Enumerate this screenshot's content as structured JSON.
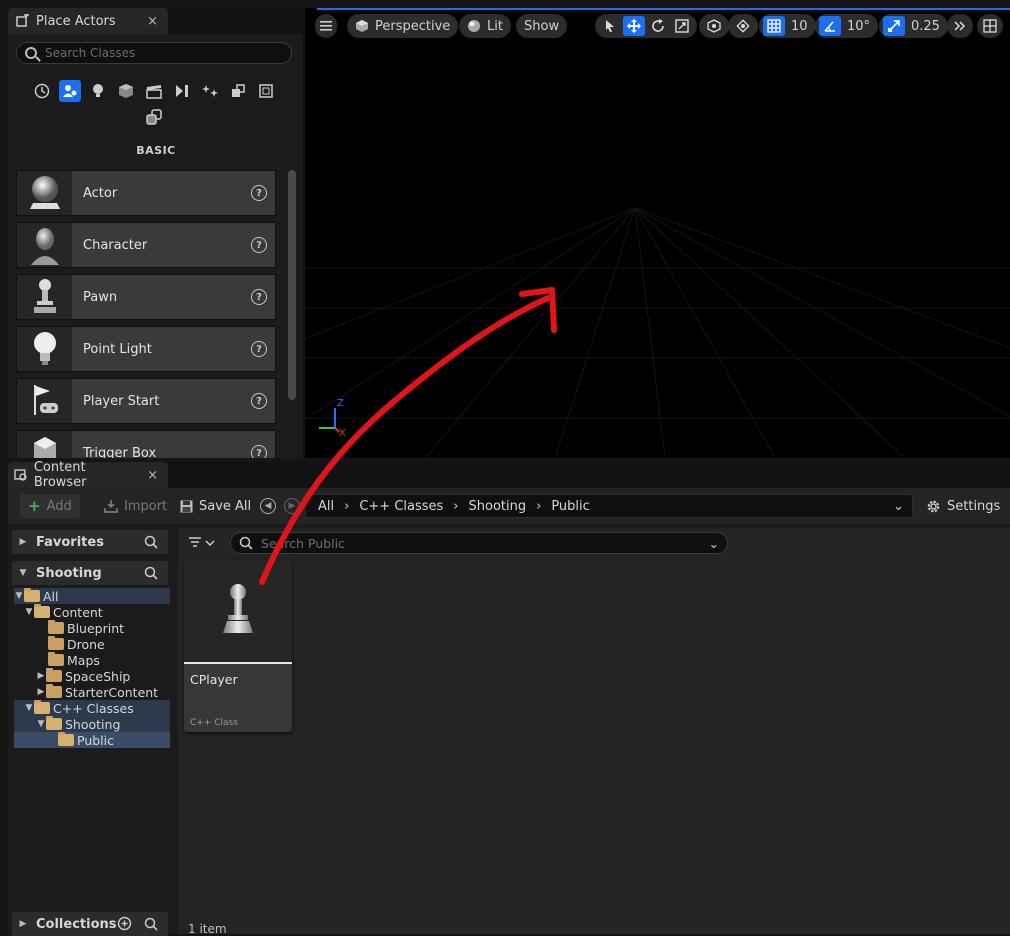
{
  "place_actors": {
    "tab_title": "Place Actors",
    "close": "×",
    "search_placeholder": "Search Classes",
    "category_label": "BASIC",
    "categories": [
      "recent-icon",
      "basic-icon",
      "lights-icon",
      "shapes-icon",
      "cinematic-icon",
      "visual-effects-icon",
      "geometry-icon",
      "volumes-icon",
      "all-classes-icon",
      "extra-icon"
    ],
    "actors": [
      {
        "name": "Actor",
        "icon": "sphere-icon"
      },
      {
        "name": "Character",
        "icon": "character-icon"
      },
      {
        "name": "Pawn",
        "icon": "pawn-icon"
      },
      {
        "name": "Point Light",
        "icon": "bulb-icon"
      },
      {
        "name": "Player Start",
        "icon": "flag-gamepad-icon"
      },
      {
        "name": "Trigger Box",
        "icon": "box-icon"
      }
    ],
    "help": "?"
  },
  "viewport": {
    "menu_icon": "hamburger-icon",
    "perspective": "Perspective",
    "lit": "Lit",
    "show": "Show",
    "grid_value": "10",
    "angle_value": "10°",
    "scale_value": "0.25",
    "axis_z": "Z",
    "axis_x": "X"
  },
  "content_browser": {
    "tab_title": "Content Browser",
    "close": "×",
    "add": "Add",
    "import": "Import",
    "save_all": "Save All",
    "settings": "Settings",
    "path": [
      "All",
      "C++ Classes",
      "Shooting",
      "Public"
    ],
    "favorites": "Favorites",
    "shooting": "Shooting",
    "collections": "Collections",
    "tree": [
      {
        "label": "All",
        "level": 0,
        "expanded": true
      },
      {
        "label": "Content",
        "level": 1,
        "expanded": true
      },
      {
        "label": "Blueprint",
        "level": 2
      },
      {
        "label": "Drone",
        "level": 2
      },
      {
        "label": "Maps",
        "level": 2
      },
      {
        "label": "SpaceShip",
        "level": 2,
        "collapsed": true
      },
      {
        "label": "StarterContent",
        "level": 2,
        "collapsed": true
      },
      {
        "label": "C++ Classes",
        "level": 1,
        "expanded": true
      },
      {
        "label": "Shooting",
        "level": 2,
        "expanded": true
      },
      {
        "label": "Public",
        "level": 3,
        "selected": true
      }
    ],
    "search_placeholder": "Search Public",
    "asset": {
      "name": "CPlayer",
      "type": "C++ Class"
    },
    "item_count": "1 item"
  },
  "colors": {
    "accent": "#1d6ff2",
    "annotation_arrow": "#e0151a",
    "folder": "#c9a164"
  }
}
